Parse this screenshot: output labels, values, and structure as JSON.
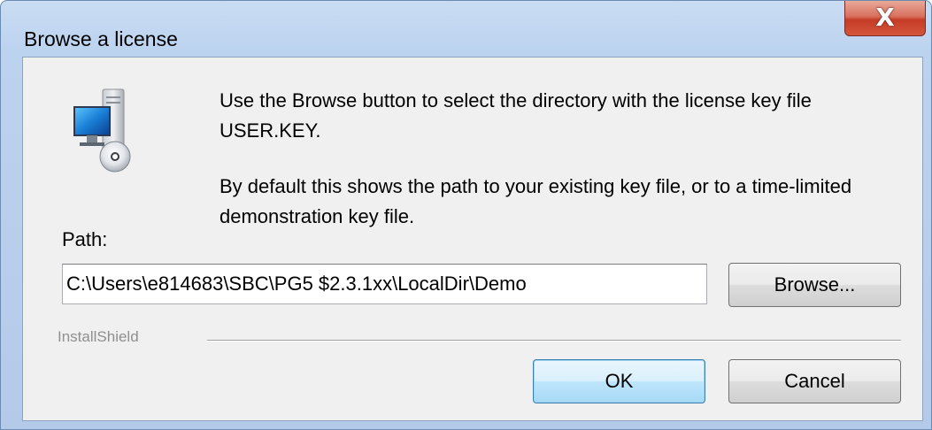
{
  "window": {
    "title": "Browse a license",
    "close_label": "X"
  },
  "dialog": {
    "icon": "computer-with-disc-icon",
    "instruction": "Use the Browse button to select the directory with the license key file USER.KEY.",
    "default_info": "By default this shows the path to your existing key file, or to a time-limited demonstration key file.",
    "path_label": "Path:",
    "path_value": "C:\\Users\\e814683\\SBC\\PG5 $2.3.1xx\\LocalDir\\Demo",
    "browse_label": "Browse...",
    "branding": "InstallShield",
    "ok_label": "OK",
    "cancel_label": "Cancel"
  },
  "colors": {
    "frame": "#b9d1ea",
    "client": "#f0f0f0",
    "close_button": "#c63c26",
    "default_button_border": "#3c7fb1"
  }
}
